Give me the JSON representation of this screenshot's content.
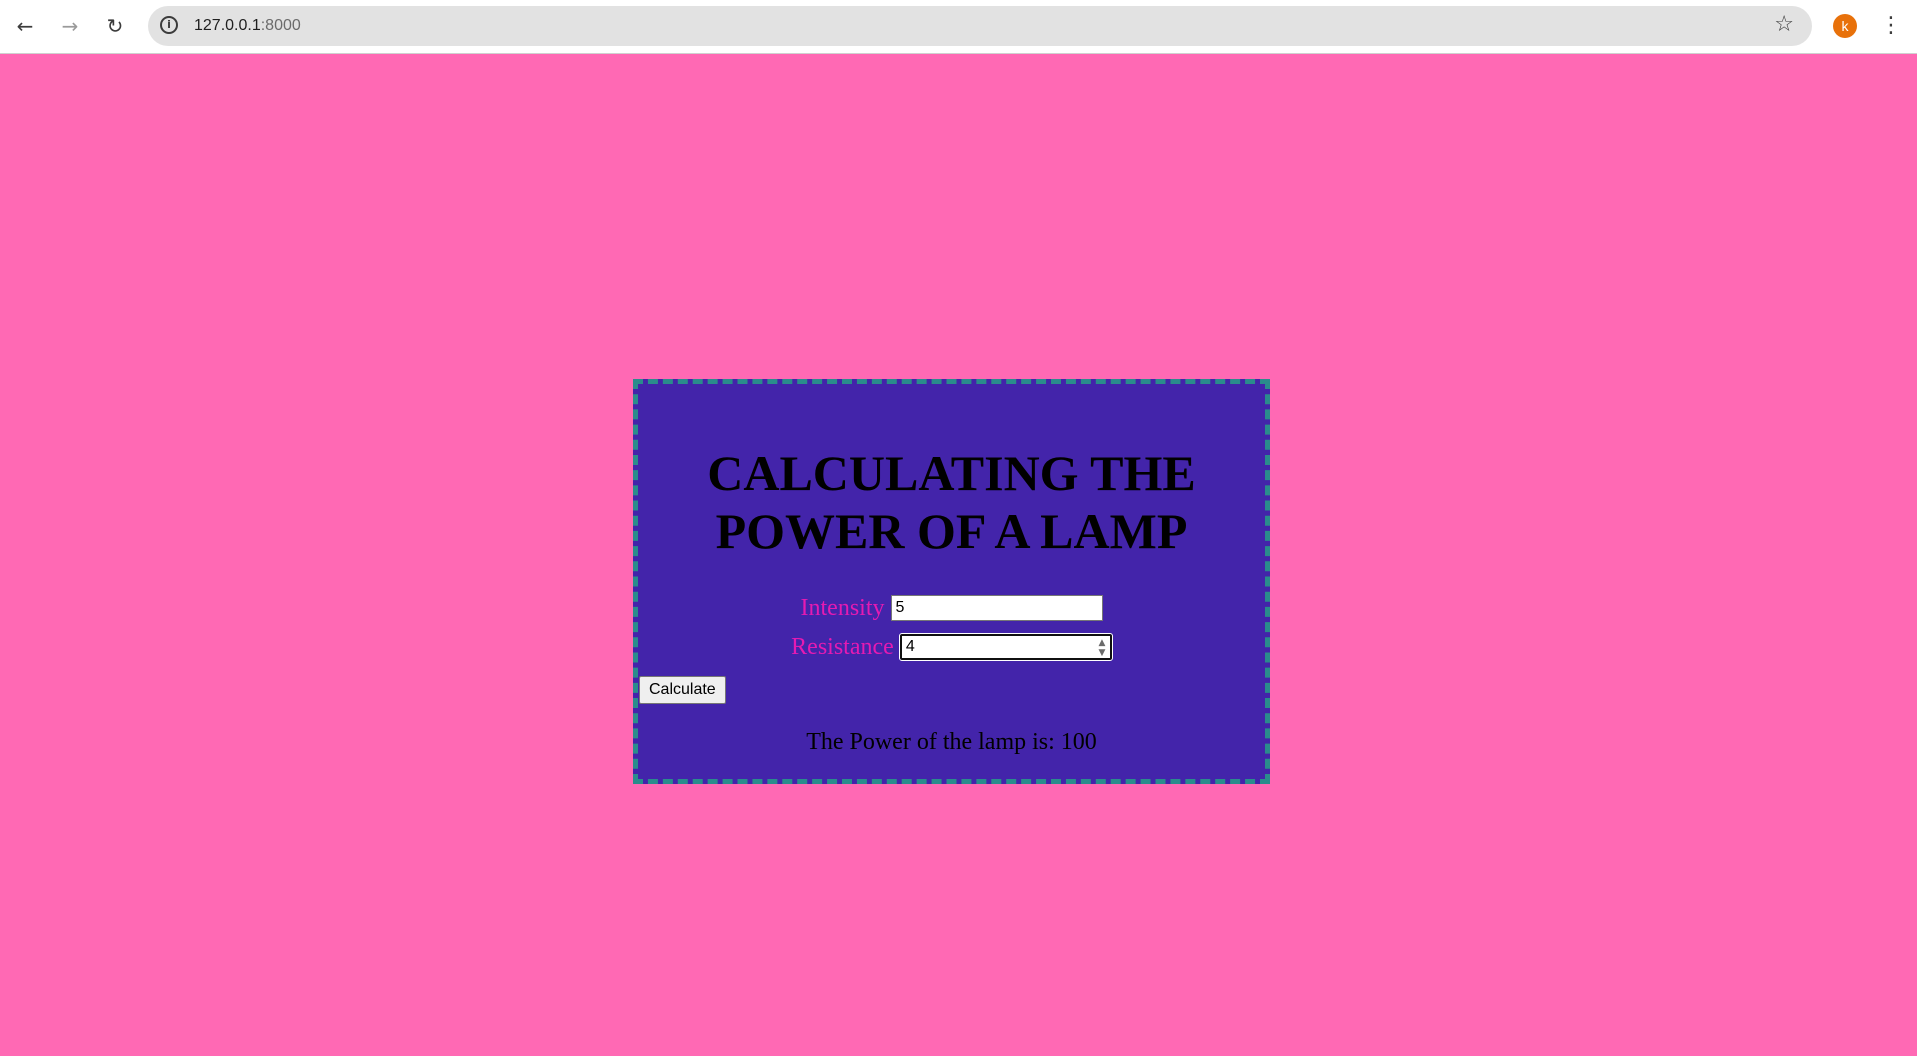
{
  "browser": {
    "url_host": "127.0.0.1",
    "url_port": ":8000",
    "avatar_letter": "k"
  },
  "page": {
    "title": "CALCULATING THE POWER OF A LAMP",
    "intensity_label": "Intensity",
    "intensity_value": "5",
    "resistance_label": "Resistance",
    "resistance_value": "4",
    "calculate_label": "Calculate",
    "result_text": "The Power of the lamp is: 100"
  },
  "colors": {
    "page_background": "#ff69b4",
    "card_background": "#4324aa",
    "card_border": "#2a8c8c",
    "label_color": "#e51ab2"
  },
  "icons": [
    "back-arrow-icon",
    "forward-arrow-icon",
    "reload-icon",
    "info-icon",
    "star-icon",
    "menu-icon"
  ]
}
